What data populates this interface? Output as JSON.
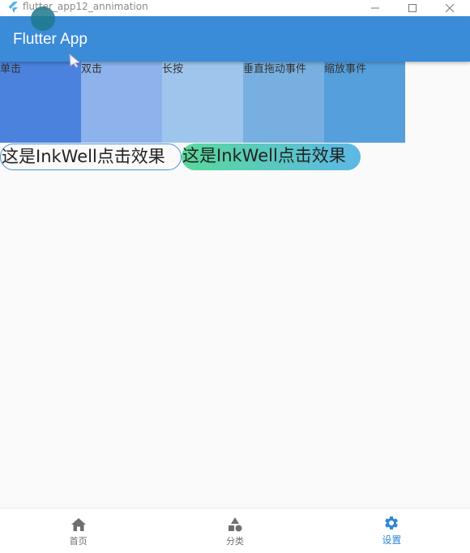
{
  "window": {
    "title": "flutter_app12_annimation"
  },
  "appbar": {
    "title": "Flutter App"
  },
  "gestures": [
    {
      "label": "单击"
    },
    {
      "label": "双击"
    },
    {
      "label": "长按"
    },
    {
      "label": "垂直拖动事件"
    },
    {
      "label": "缩放事件"
    }
  ],
  "inkwell": {
    "outlined_label": "这是InkWell点击效果",
    "gradient_label": "这是InkWell点击效果"
  },
  "bottom_nav": {
    "items": [
      {
        "label": "首页",
        "icon": "home-icon"
      },
      {
        "label": "分类",
        "icon": "category-icon"
      },
      {
        "label": "设置",
        "icon": "settings-icon",
        "active": true
      }
    ]
  },
  "colors": {
    "appbar": "#3a8bd8",
    "accent": "#2f86d8",
    "gesture_boxes": [
      "#4b82dd",
      "#8db2ec",
      "#9ec6ec",
      "#77b0e0",
      "#559fdc"
    ]
  }
}
